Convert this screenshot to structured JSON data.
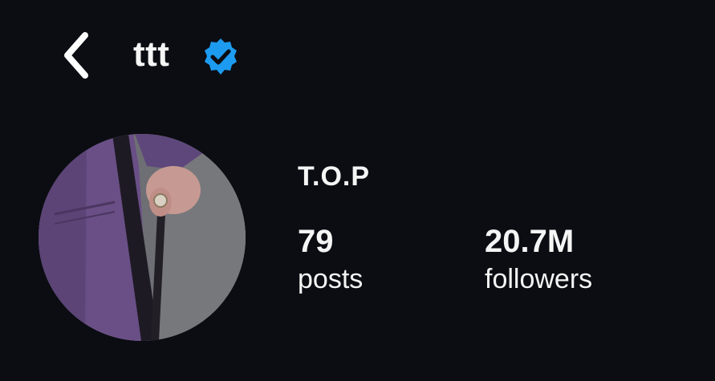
{
  "header": {
    "back_icon": "chevron-left-icon",
    "username": "ttt",
    "verified_icon": "verified-badge-icon",
    "verified_color": "#1d9bf0"
  },
  "profile": {
    "display_name": "T.O.P",
    "avatar": "profile-photo",
    "stats": {
      "posts_count": "79",
      "posts_label": "posts",
      "followers_count": "20.7M",
      "followers_label": "followers"
    }
  },
  "colors": {
    "background": "#0b0d13",
    "text": "#f5f5f5",
    "accent": "#1d9bf0"
  }
}
